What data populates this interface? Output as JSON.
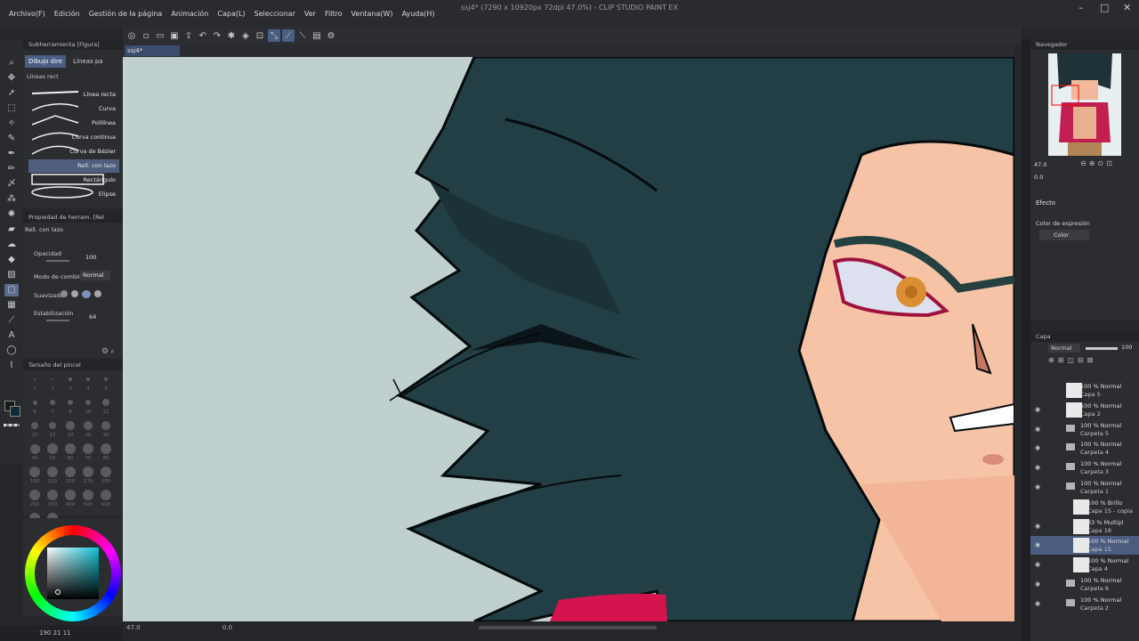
{
  "app": {
    "window_title": "ssj4* (7290 x 10920px 72dpi 47.0%) - CLIP STUDIO PAINT EX",
    "menus": [
      "Archivo(F)",
      "Edición",
      "Gestión de la página",
      "Animación",
      "Capa(L)",
      "Seleccionar",
      "Ver",
      "Filtro",
      "Ventana(W)",
      "Ayuda(H)"
    ],
    "document_tab": "ssj4*"
  },
  "sub_tool": {
    "panel_title": "Subherramienta [Figura]",
    "tabs": [
      "Dibujo dire",
      "Líneas pa"
    ],
    "group_label": "Líneas rect",
    "items": [
      "Línea recta",
      "Curva",
      "Polilínea",
      "Curva continua",
      "Curva de Bézier",
      "Rell. con lazo",
      "Rectángulo",
      "Elipse"
    ],
    "selected": "Rell. con lazo"
  },
  "tool_property": {
    "panel_title": "Propiedad de herram. [Rel",
    "tool_name": "Rell. con lazo",
    "opacity_label": "Opacidad",
    "opacity_value": "100",
    "blend_label": "Modo de combina",
    "blend_value": "Normal",
    "smoothing_label": "Suavizado",
    "stabilization_label": "Estabilización",
    "stabilization_value": "64"
  },
  "brush_size": {
    "panel_title": "Tamaño del pincel",
    "sizes": [
      "1",
      "2",
      "3",
      "4",
      "5",
      "6",
      "7",
      "8",
      "10",
      "12",
      "15",
      "17",
      "20",
      "25",
      "30",
      "40",
      "50",
      "60",
      "70",
      "80",
      "100",
      "120",
      "150",
      "170",
      "200",
      "250",
      "300",
      "400",
      "500",
      "600",
      "700",
      "800"
    ]
  },
  "status": {
    "left_values": "190  21  11",
    "zoom": "47.0",
    "rotation": "0.0"
  },
  "navigator": {
    "title": "Navegador",
    "zoom": "47.0",
    "rotation": "0.0"
  },
  "effect_panel": {
    "title": "Efecto",
    "expression_label": "Color de expresión",
    "expression_value": "Color"
  },
  "layers": {
    "title": "Capa",
    "blend": "Normal",
    "opacity": "100",
    "rows": [
      {
        "line1": "100 % Normal",
        "line2": "Capa 5",
        "type": "layer",
        "eye": false,
        "selected": false,
        "indent": 0
      },
      {
        "line1": "100 % Normal",
        "line2": "Capa 2",
        "type": "layer",
        "eye": true,
        "selected": false,
        "indent": 0
      },
      {
        "line1": "100 % Normal",
        "line2": "Carpeta 5",
        "type": "folder",
        "eye": true,
        "selected": false,
        "indent": 0
      },
      {
        "line1": "100 % Normal",
        "line2": "Carpeta 4",
        "type": "folder",
        "eye": true,
        "selected": false,
        "indent": 0
      },
      {
        "line1": "100 % Normal",
        "line2": "Carpeta 3",
        "type": "folder",
        "eye": true,
        "selected": false,
        "indent": 0
      },
      {
        "line1": "100 % Normal",
        "line2": "Carpeta 1",
        "type": "folder",
        "eye": true,
        "selected": false,
        "indent": 0
      },
      {
        "line1": "100 % Brillo",
        "line2": "Capa 15 - copia",
        "type": "layer",
        "eye": false,
        "selected": false,
        "indent": 1
      },
      {
        "line1": "83 % Multipl",
        "line2": "Capa 16",
        "type": "layer",
        "eye": true,
        "selected": false,
        "indent": 1
      },
      {
        "line1": "100 % Normal",
        "line2": "Capa 15",
        "type": "layer",
        "eye": true,
        "selected": true,
        "indent": 1
      },
      {
        "line1": "100 % Normal",
        "line2": "Capa 4",
        "type": "layer",
        "eye": true,
        "selected": false,
        "indent": 1
      },
      {
        "line1": "100 % Normal",
        "line2": "Carpeta 6",
        "type": "folder",
        "eye": true,
        "selected": false,
        "indent": 0
      },
      {
        "line1": "100 % Normal",
        "line2": "Carpeta 2",
        "type": "folder",
        "eye": true,
        "selected": false,
        "indent": 0
      }
    ]
  }
}
